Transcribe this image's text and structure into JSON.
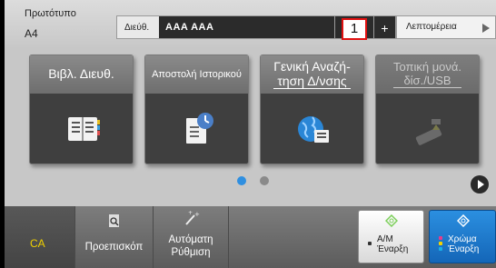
{
  "header": {
    "original_label": "Πρωτότυπο",
    "original_value": "A4",
    "address_label": "Διεύθ.",
    "address_value": "AAA   AAA",
    "copies": "1",
    "plus_label": "+",
    "details_label": "Λεπτομέρεια"
  },
  "tiles": [
    {
      "label": "Βιβλ. Διευθ.",
      "icon": "address-book-icon",
      "enabled": true
    },
    {
      "label": "Αποστολή Ιστορικού",
      "icon": "send-history-icon",
      "enabled": true
    },
    {
      "label_line1": "Γενική Αναζή-",
      "label_line2": "τηση Δ/νσης",
      "icon": "global-address-search-icon",
      "enabled": true
    },
    {
      "label_line1": "Τοπική μονά.",
      "label_line2": "δίσ./USB",
      "icon": "usb-drive-icon",
      "enabled": false
    }
  ],
  "pagination": {
    "pages": 2,
    "current": 1,
    "active_color": "#2f8fe0",
    "inactive_color": "#8a8a8a"
  },
  "bottom": {
    "ca_label": "CA",
    "preview_label": "Προεπισκόπ",
    "auto_label_line1": "Αυτόματη",
    "auto_label_line2": "Ρύθμιση",
    "bw_start_line1": "Α/Μ",
    "bw_start_line2": "Έναρξη",
    "color_start_line1": "Χρώμα",
    "color_start_line2": "Έναρξη"
  },
  "colors": {
    "accent_blue": "#1e7ad0",
    "ca_yellow": "#f0d000",
    "highlight_red": "#e01010"
  }
}
